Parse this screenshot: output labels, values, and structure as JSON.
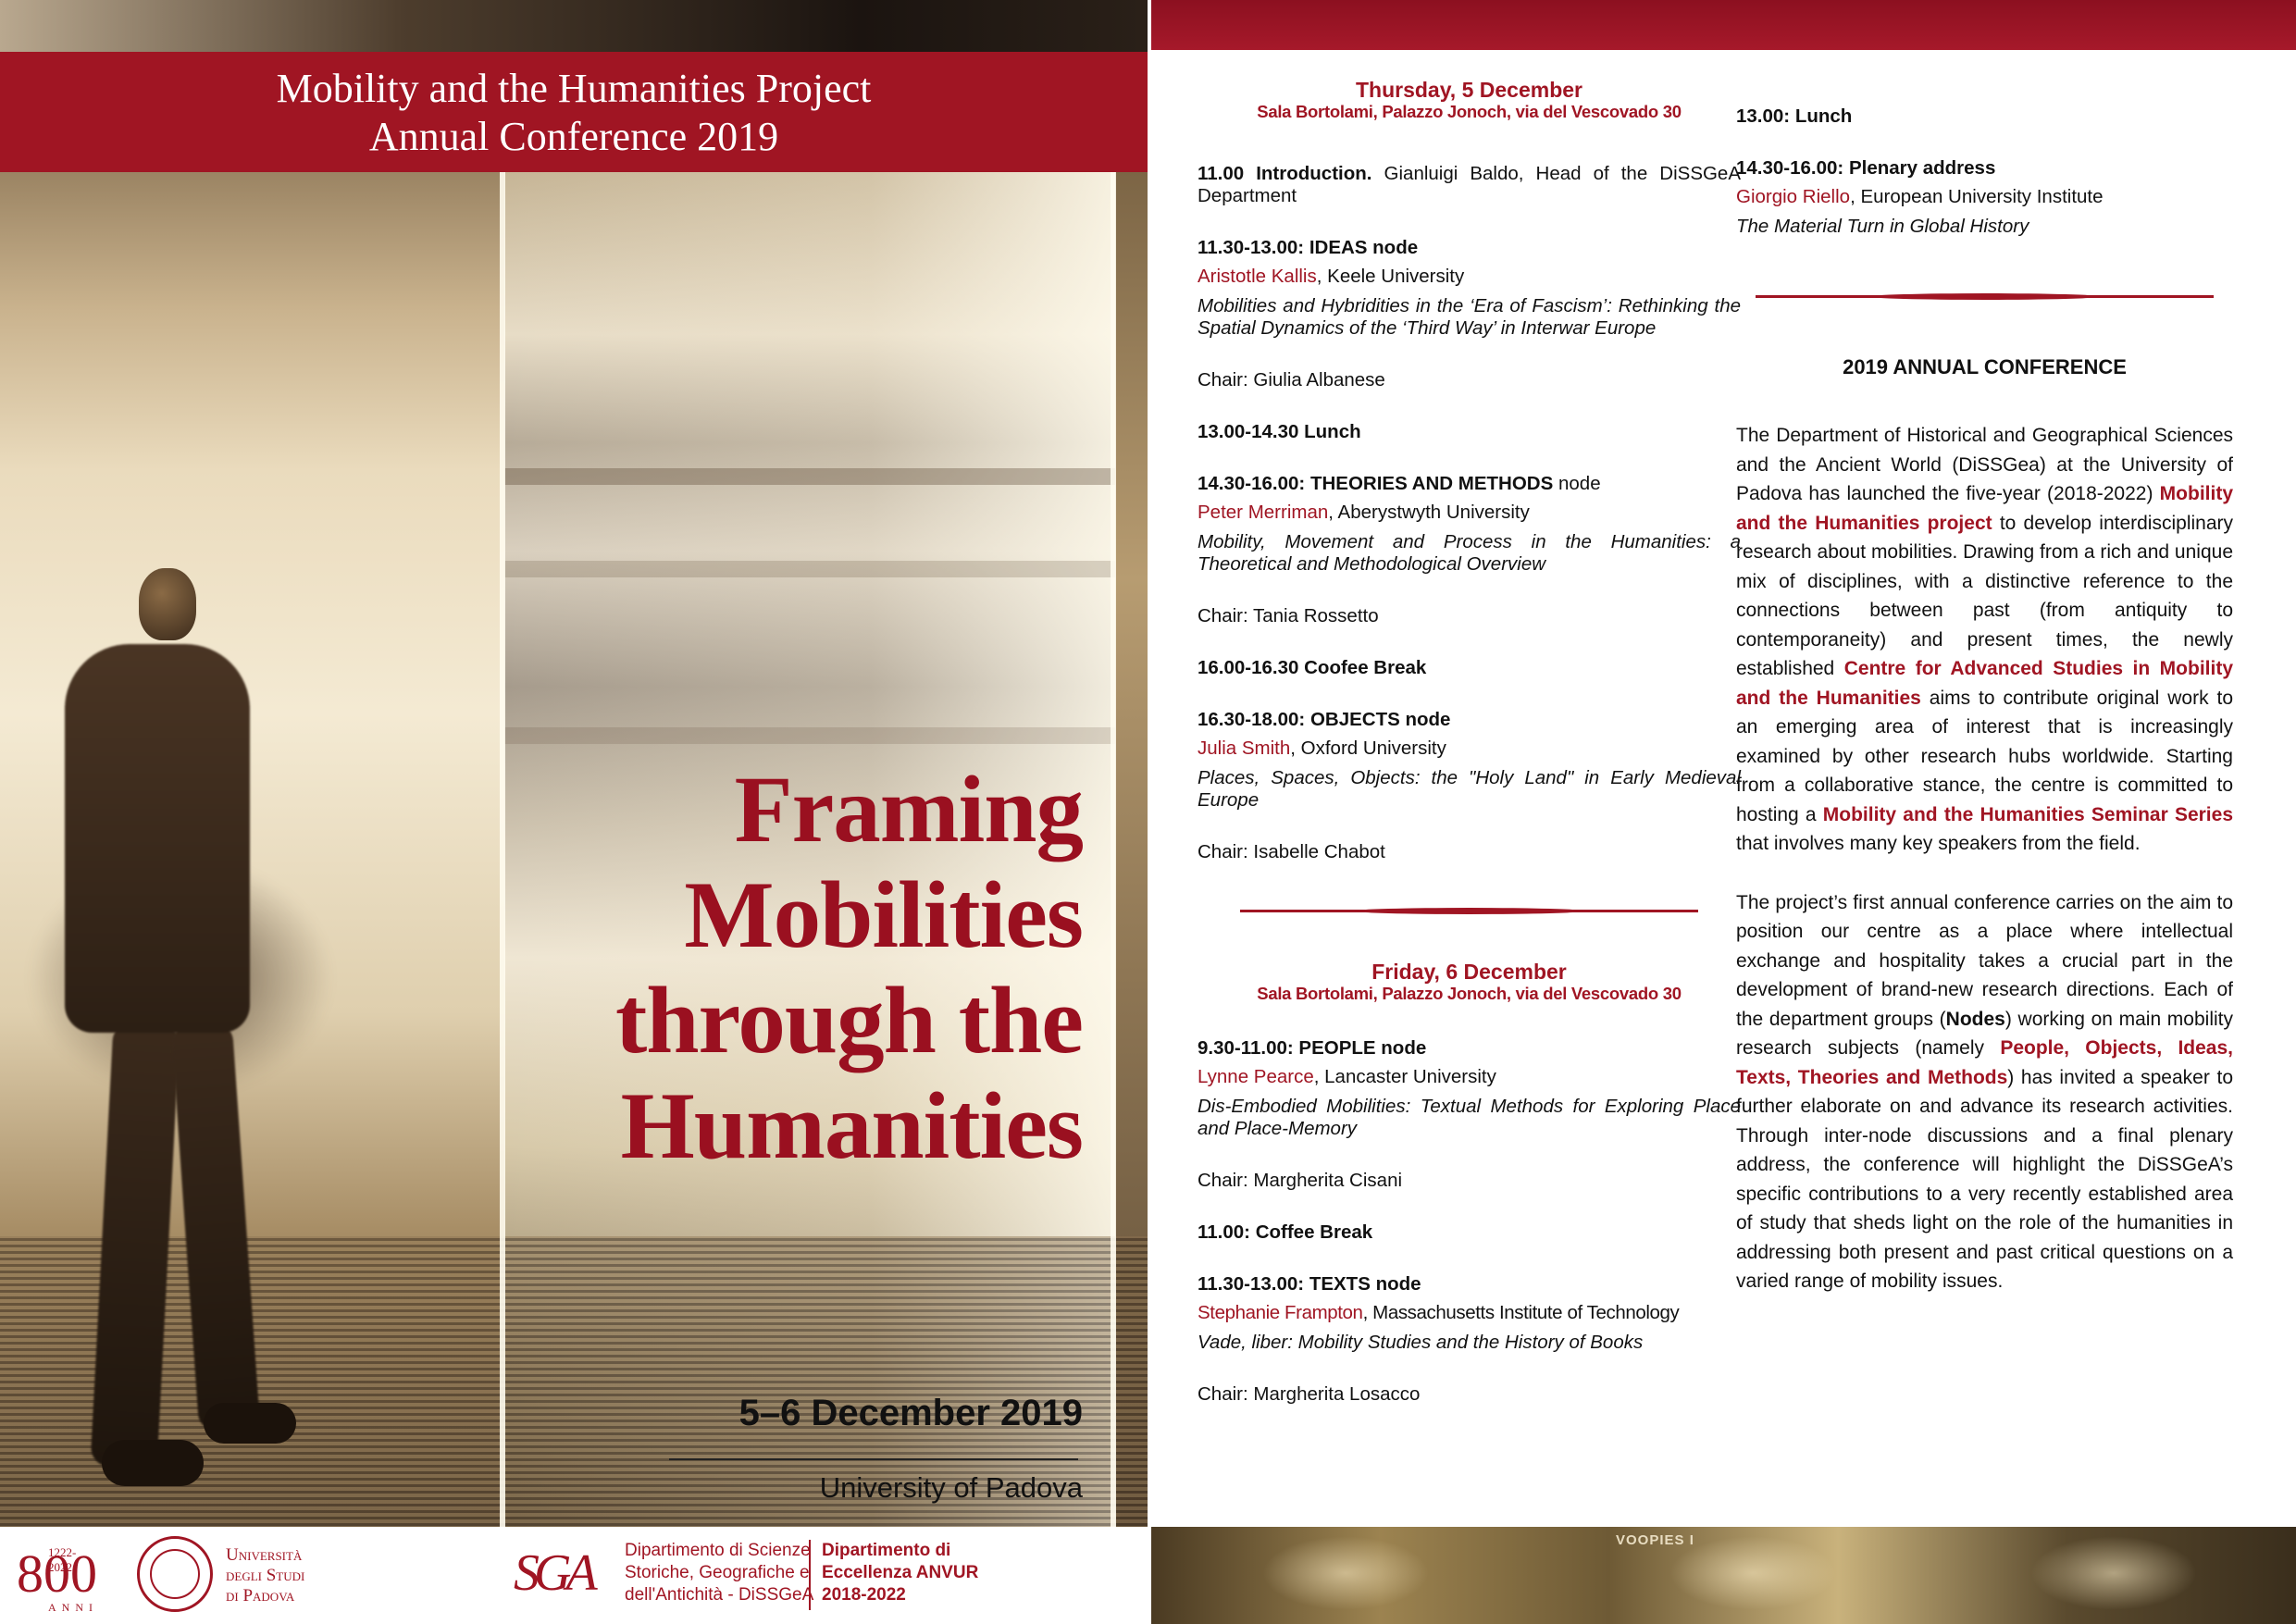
{
  "cover": {
    "header_line1": "Mobility and the Humanities Project",
    "header_line2": "Annual Conference 2019",
    "title_lines": [
      "Framing",
      "Mobilities",
      "through the",
      "Humanities"
    ],
    "dates": "5–6 December 2019",
    "venue": "University of Padova"
  },
  "logos": {
    "anniversary_number": "800",
    "anniversary_years": "1222-2022",
    "anniversary_word": "ANNI",
    "university_lines": [
      "Università",
      "degli Studi",
      "di Padova"
    ],
    "department_mark": "SGA",
    "department_lines": [
      "Dipartimento di Scienze",
      "Storiche, Geografiche e",
      "dell'Antichità - DiSSGeA"
    ],
    "excellence_lines": [
      "Dipartimento di",
      "Eccellenza ANVUR",
      "2018-2022"
    ]
  },
  "program": {
    "thursday": {
      "day": "Thursday, 5 December",
      "venue": "Sala Bortolami, Palazzo Jonoch, via del Vescovado 30",
      "intro": {
        "time": "11.00 Introduction.",
        "text": "Gianluigi Baldo, Head of the DiSSGeA Department"
      },
      "ideas": {
        "time": "11.30-13.00: IDEAS node",
        "speaker": "Aristotle Kallis",
        "affiliation": ", Keele University",
        "talk": "Mobilities and Hybridities in the ‘Era of Fascism’: Rethinking the Spatial Dynamics of the ‘Third Way’ in Interwar Europe",
        "chair": "Chair: Giulia Albanese"
      },
      "lunch": "13.00-14.30 Lunch",
      "theories": {
        "time": "14.30-16.00: THEORIES AND METHODS",
        "time_suffix": " node",
        "speaker": "Peter Merriman",
        "affiliation": ", Aberystwyth University",
        "talk": "Mobility, Movement and Process in the Humanities: a Theoretical and Methodological Overview",
        "chair": "Chair: Tania Rossetto"
      },
      "break": "16.00-16.30 Coofee Break",
      "objects": {
        "time": "16.30-18.00: OBJECTS node",
        "speaker": "Julia Smith",
        "affiliation": ", Oxford University",
        "talk": "Places, Spaces, Objects: the \"Holy Land\" in Early Medieval Europe",
        "chair": "Chair: Isabelle Chabot"
      }
    },
    "friday": {
      "day": "Friday, 6 December",
      "venue": "Sala Bortolami, Palazzo Jonoch, via del Vescovado 30",
      "people": {
        "time": "9.30-11.00: PEOPLE node",
        "speaker": "Lynne Pearce",
        "affiliation": ", Lancaster University",
        "talk": "Dis-Embodied Mobilities: Textual Methods for Exploring Place and Place-Memory",
        "chair": "Chair: Margherita Cisani"
      },
      "break": "11.00: Coffee Break",
      "texts": {
        "time": "11.30-13.00: TEXTS node",
        "speaker": "Stephanie Frampton",
        "affiliation": ", Massachusetts Institute of Technology",
        "talk": "Vade, liber: Mobility Studies and the History of Books",
        "chair": "Chair: Margherita Losacco"
      },
      "lunch": "13.00: Lunch",
      "plenary": {
        "time": "14.30-16.00: Plenary address",
        "speaker": "Giorgio Riello",
        "affiliation": ", European University Institute",
        "talk": "The Material Turn in Global History"
      }
    }
  },
  "about": {
    "heading": "2019 ANNUAL CONFERENCE",
    "p1": {
      "a": "The Department of Historical and Geographical Sciences and the Ancient World (DiSSGea) at the University of Padova has launched the five-year (2018-2022) ",
      "h1": "Mobility and the Humanities project",
      "b": " to develop interdisciplinary research about mobilities. Drawing from a rich and unique mix of disciplines, with a distinctive reference to the connections between past (from antiquity to contemporaneity) and present times, the newly established ",
      "h2": "Centre for Advanced Studies in Mobility and the Humanities",
      "c": " aims to contribute original work to an emerging area of interest that is increasingly examined by other research hubs worldwide. Starting from a collaborative stance, the centre is committed to hosting a ",
      "h3": "Mobility and the Humanities Seminar Series",
      "d": " that involves many key speakers from the field."
    },
    "p2": {
      "a": "The project’s first annual conference carries on the aim to position our centre as a place where intellectual exchange and hospitality takes a crucial part in the development of brand-new research directions. Each of the department groups (",
      "b1": "Nodes",
      "b": ") working on main mobility research subjects (namely ",
      "h1": "People, Objects, Ideas, Texts, Theories and Methods",
      "c": ") has invited a speaker to further elaborate on and advance its research activities. Through inter-node discussions and a final plenary address, the conference will highlight the DiSSGeA’s specific contributions to a very recently established area of study that sheds light on the role of the humanities in addressing both present and past critical questions on a varied range of mobility issues."
    },
    "photo_sign": "VOOPIES I"
  },
  "colors": {
    "accent": "#a01523",
    "title_red": "#9a1020",
    "text": "#111111"
  }
}
